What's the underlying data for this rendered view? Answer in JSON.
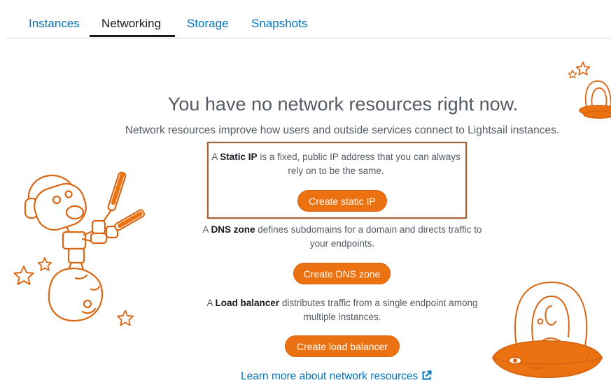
{
  "tabs": [
    {
      "label": "Instances",
      "active": false
    },
    {
      "label": "Networking",
      "active": true
    },
    {
      "label": "Storage",
      "active": false
    },
    {
      "label": "Snapshots",
      "active": false
    }
  ],
  "empty_state": {
    "title": "You have no network resources right now.",
    "subtitle": "Network resources improve how users and outside services connect to Lightsail instances."
  },
  "static_ip": {
    "prefix": "A ",
    "term": "Static IP",
    "rest": " is a fixed, public IP address that you can always rely on to be the same.",
    "button": "Create static IP"
  },
  "dns_zone": {
    "prefix": "A ",
    "term": "DNS zone",
    "rest": " defines subdomains for a domain and directs traffic to your endpoints.",
    "button": "Create DNS zone"
  },
  "load_balancer": {
    "prefix": "A ",
    "term": "Load balancer",
    "rest": " distributes traffic from a single endpoint among multiple instances.",
    "button": "Create load balancer"
  },
  "learn_more": {
    "label": "Learn more about network resources",
    "icon": "external-link-icon"
  },
  "colors": {
    "accent": "#ec7211",
    "link": "#0073bb",
    "text": "#545b64",
    "highlight_border": "#a6612d"
  },
  "illustrations": [
    "robot-astronaut-illustration",
    "star-icon",
    "alien-in-ufo-illustration"
  ]
}
